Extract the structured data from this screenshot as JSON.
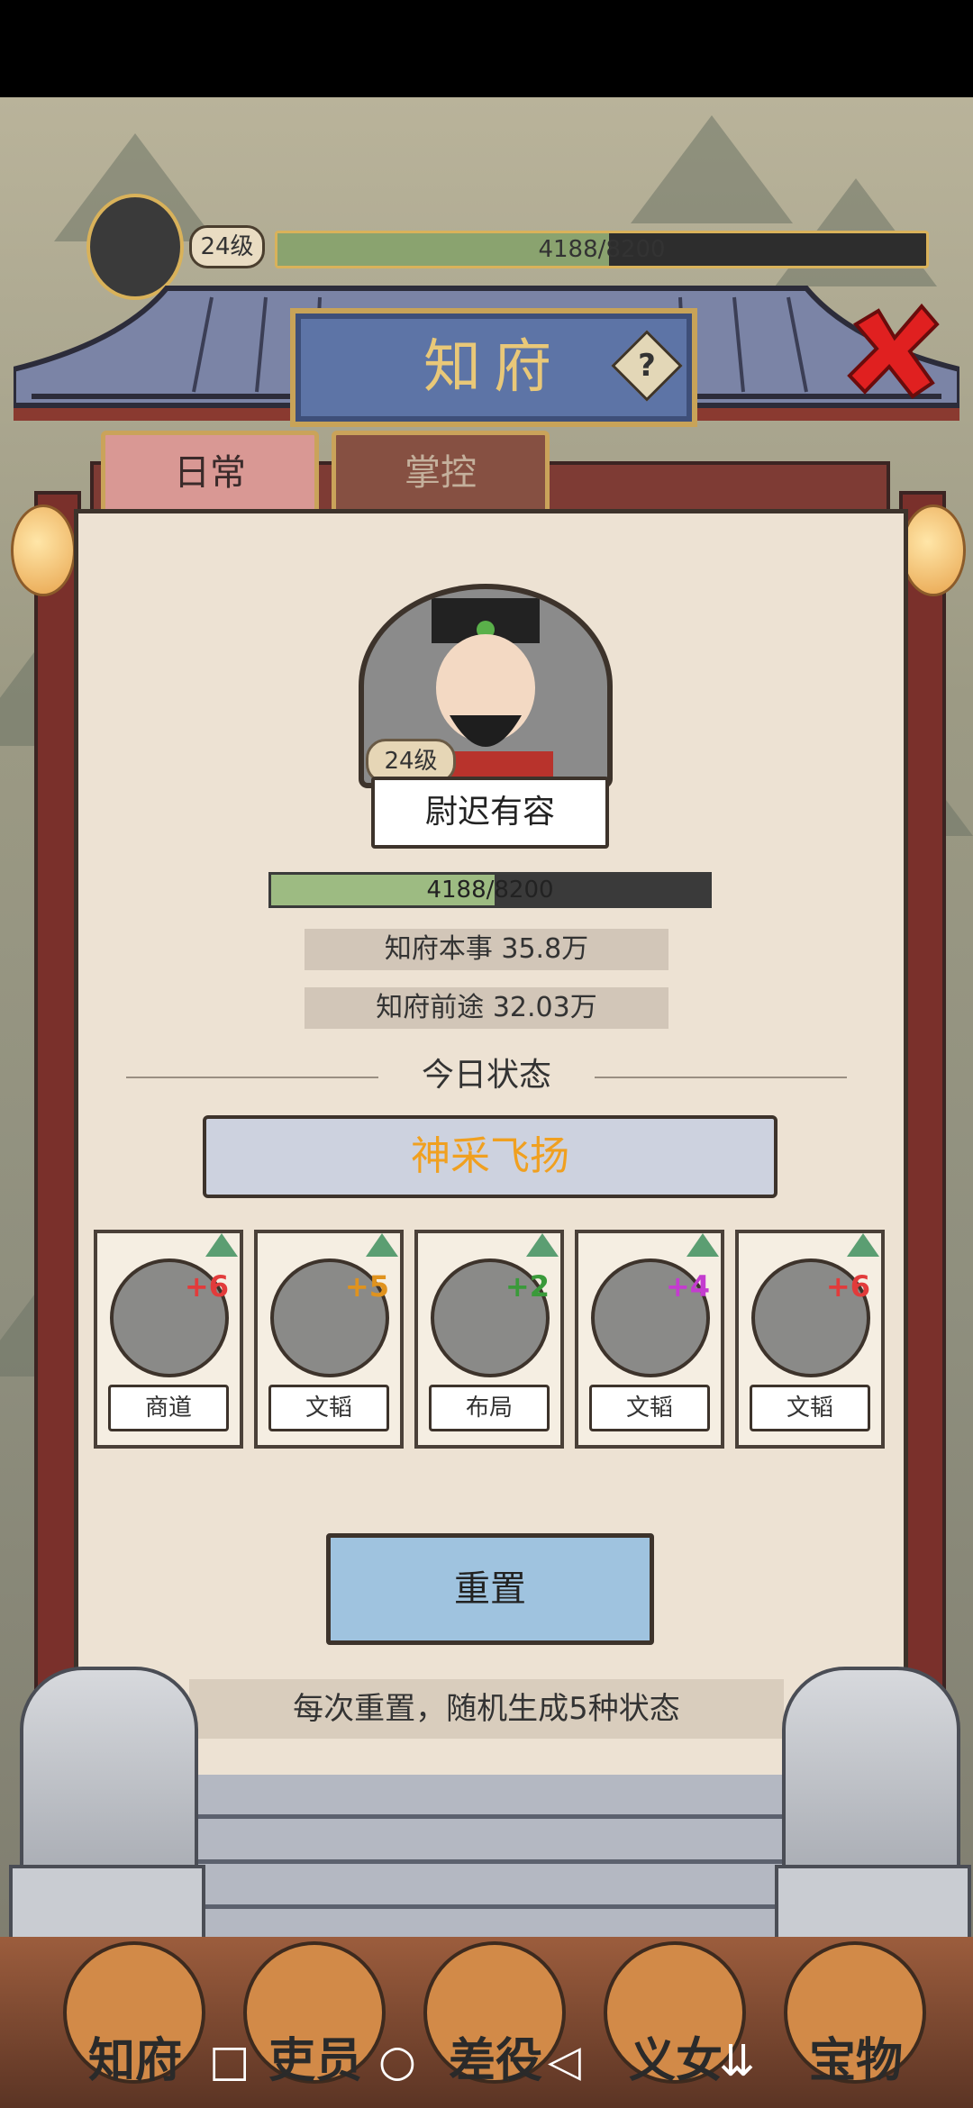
{
  "hud": {
    "level": "24级",
    "exp_text": "4188/8200",
    "exp_fraction": 0.511
  },
  "title": "知府",
  "help_icon": "question-icon",
  "close_icon": "close-x-icon",
  "tabs": [
    {
      "label": "日常",
      "active": true
    },
    {
      "label": "掌控",
      "active": false
    }
  ],
  "official": {
    "level": "24级",
    "name": "尉迟有容",
    "exp_text": "4188/8200",
    "exp_fraction": 0.511,
    "stat_ability": "知府本事  35.8万",
    "stat_prospect": "知府前途  32.03万"
  },
  "today": {
    "title": "今日状态",
    "status": "神采飞扬"
  },
  "cards": [
    {
      "label": "商道",
      "bonus": "+6",
      "bonus_color": "#e23b3b",
      "icon": "treasure-chest-icon"
    },
    {
      "label": "文韬",
      "bonus": "+5",
      "bonus_color": "#e0931e",
      "icon": "scholar-reading-icon"
    },
    {
      "label": "布局",
      "bonus": "+2",
      "bonus_color": "#3a9a3a",
      "icon": "scroll-recommendation-icon"
    },
    {
      "label": "文韬",
      "bonus": "+4",
      "bonus_color": "#c43ccf",
      "icon": "scholar-reading-icon"
    },
    {
      "label": "文韬",
      "bonus": "+6",
      "bonus_color": "#e23b3b",
      "icon": "scholar-reading-icon"
    }
  ],
  "reset_button": "重置",
  "reset_note": "每次重置，随机生成5种状态",
  "bottom_nav": [
    "知府",
    "吏员",
    "差役",
    "义女",
    "宝物"
  ],
  "system_nav": [
    "square-icon",
    "circle-icon",
    "back-triangle-icon",
    "download-icon"
  ]
}
